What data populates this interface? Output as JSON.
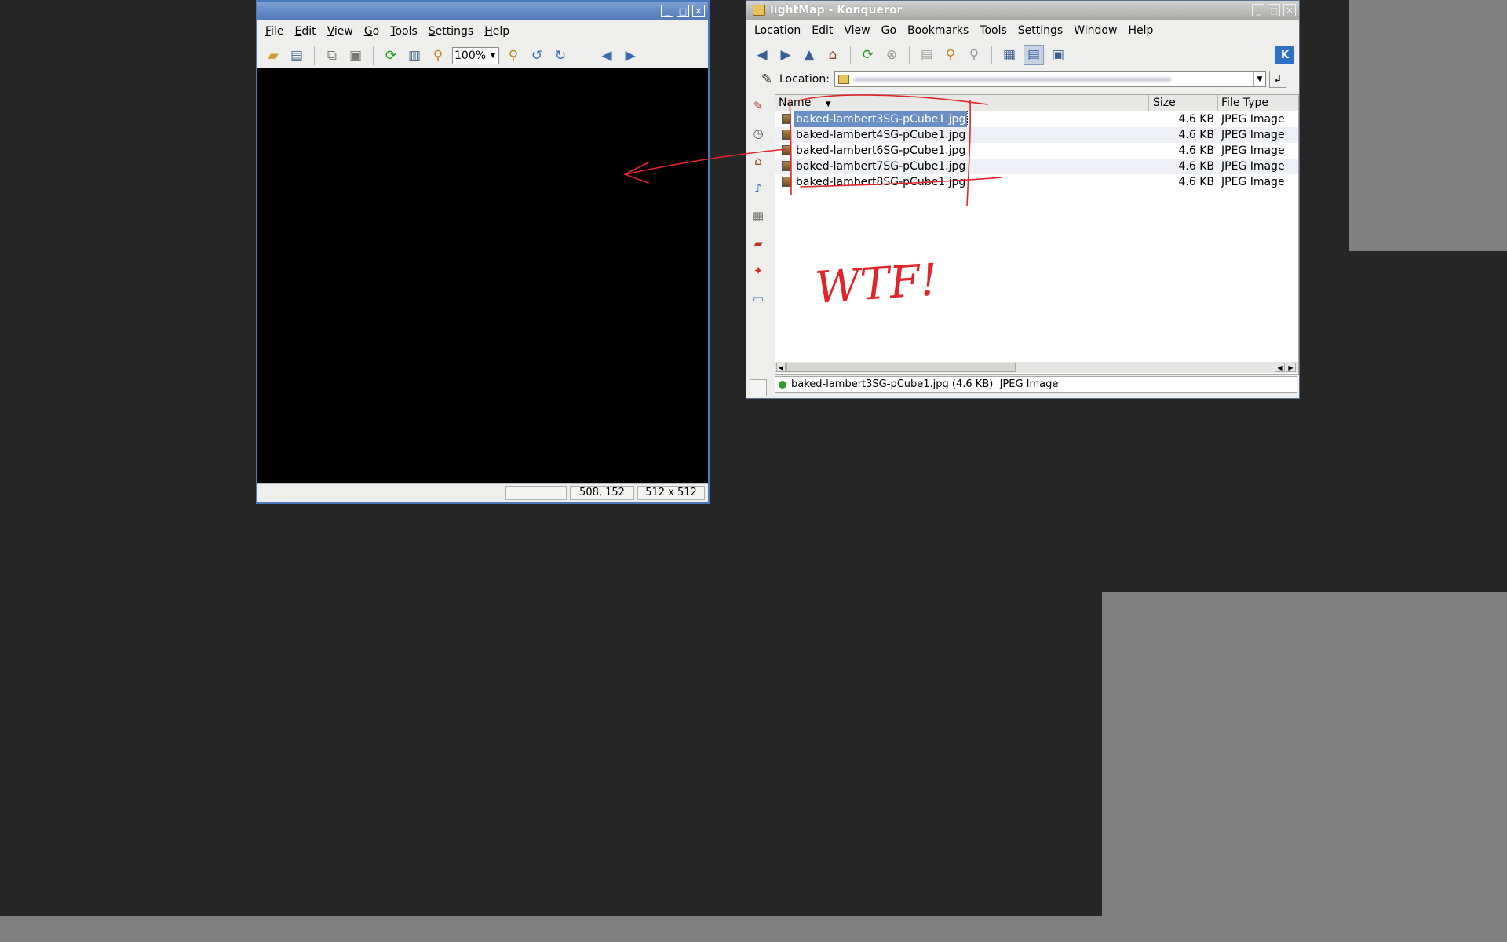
{
  "image_viewer": {
    "menu": [
      "File",
      "Edit",
      "View",
      "Go",
      "Tools",
      "Settings",
      "Help"
    ],
    "zoom": "100%",
    "status": {
      "left": "",
      "coords": "508, 152",
      "dimensions": "512 x 512"
    }
  },
  "konqueror": {
    "title": "lightMap - Konqueror",
    "menu": [
      "Location",
      "Edit",
      "View",
      "Go",
      "Bookmarks",
      "Tools",
      "Settings",
      "Window",
      "Help"
    ],
    "location_label": "Location:",
    "location_value": "",
    "columns": {
      "name": "Name",
      "size": "Size",
      "type": "File Type"
    },
    "files": [
      {
        "name": "baked-lambert3SG-pCube1.jpg",
        "size": "4.6 KB",
        "type": "JPEG Image",
        "selected": true
      },
      {
        "name": "baked-lambert4SG-pCube1.jpg",
        "size": "4.6 KB",
        "type": "JPEG Image",
        "selected": false
      },
      {
        "name": "baked-lambert6SG-pCube1.jpg",
        "size": "4.6 KB",
        "type": "JPEG Image",
        "selected": false
      },
      {
        "name": "baked-lambert7SG-pCube1.jpg",
        "size": "4.6 KB",
        "type": "JPEG Image",
        "selected": false
      },
      {
        "name": "baked-lambert8SG-pCube1.jpg",
        "size": "4.6 KB",
        "type": "JPEG Image",
        "selected": false
      }
    ],
    "status_text": "baked-lambert3SG-pCube1.jpg (4.6 KB)  JPEG Image"
  },
  "annotation": {
    "text": "WTF!",
    "color": "#e0252b"
  },
  "colors": {
    "desktop": "#262626",
    "desktop_gray": "#808080",
    "titlebar": "#5c7fb4",
    "selection": "#6a8fc4"
  }
}
